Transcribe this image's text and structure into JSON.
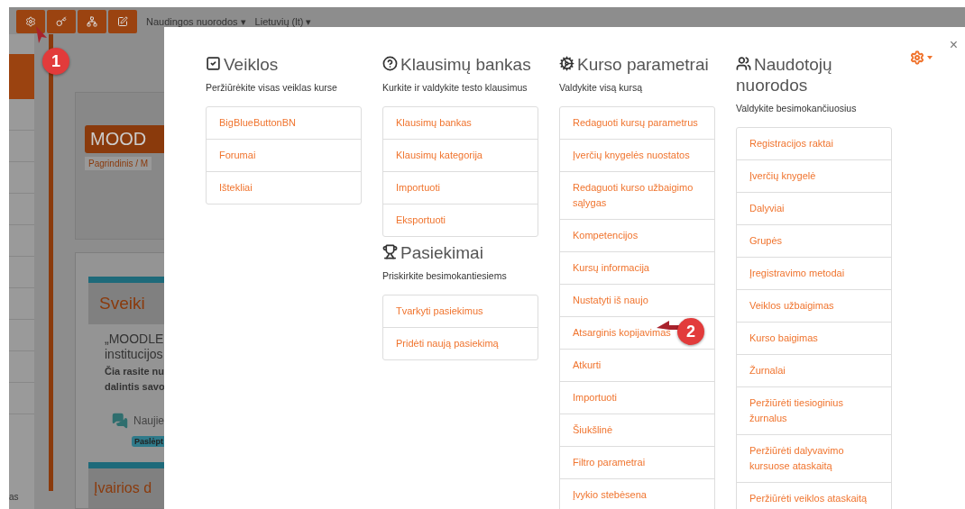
{
  "toolbar": {
    "menus": [
      {
        "label": "Naudingos nuorodos",
        "caret": "▾"
      },
      {
        "label": "Lietuvių (lt)",
        "caret": "▾"
      }
    ]
  },
  "background_page": {
    "sidebar_text": "as",
    "banner_title": "MOOD",
    "breadcrumb": "Pagrindinis / M",
    "welcome_title": "Sveiki",
    "intro_lines": [
      "„MOODLE",
      "institucijos"
    ],
    "bold_lines": [
      "Čia rasite nu",
      "dalintis savo"
    ],
    "forum_label": "Naujie",
    "hidden_badge": "Paslėpt",
    "section_title": "Įvairios d"
  },
  "annotations": [
    {
      "number": "1"
    },
    {
      "number": "2"
    }
  ],
  "modal": {
    "close": "×",
    "columns": [
      {
        "sections": [
          {
            "title": "Veiklos",
            "description": "Peržiūrėkite visas veiklas kurse",
            "links": [
              "BigBlueButtonBN",
              "Forumai",
              "Ištekliai"
            ]
          }
        ]
      },
      {
        "sections": [
          {
            "title": "Klausimų bankas",
            "description": "Kurkite ir valdykite testo klausimus",
            "links": [
              "Klausimų bankas",
              "Klausimų kategorija",
              "Importuoti",
              "Eksportuoti"
            ]
          },
          {
            "title": "Pasiekimai",
            "description": "Priskirkite besimokantiesiems",
            "links": [
              "Tvarkyti pasiekimus",
              "Pridėti naują pasiekimą"
            ]
          }
        ]
      },
      {
        "sections": [
          {
            "title": "Kurso parametrai",
            "description": "Valdykite visą kursą",
            "links": [
              "Redaguoti kursų parametrus",
              "Įverčių knygelės nuostatos",
              "Redaguoti kurso užbaigimo sąlygas",
              "Kompetencijos",
              "Kursų informacija",
              "Nustatyti iš naujo",
              "Atsarginis kopijavimas",
              "Atkurti",
              "Importuoti",
              "Šiukšlinė",
              "Filtro parametrai",
              "Įvykio stebėsena"
            ]
          }
        ]
      },
      {
        "sections": [
          {
            "title": "Naudotojų nuorodos",
            "description": "Valdykite besimokančiuosius",
            "links": [
              "Registracijos raktai",
              "Įverčių knygelė",
              "Dalyviai",
              "Grupės",
              "Įregistravimo metodai",
              "Veiklos užbaigimas",
              "Kurso baigimas",
              "Žurnalai",
              "Peržiūrėti tiesioginius žurnalus",
              "Peržiūrėti dalyvavimo kursuose ataskaitą",
              "Peržiūrėti veiklos ataskaitą"
            ]
          }
        ]
      }
    ]
  }
}
